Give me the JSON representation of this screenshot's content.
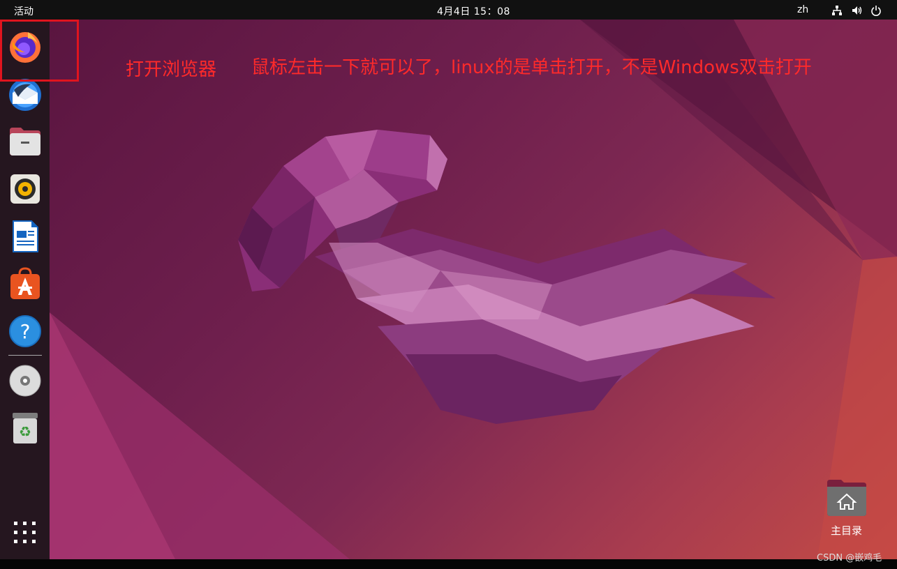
{
  "topbar": {
    "activities": "活动",
    "clock": "4月4日  15：08",
    "language": "zh",
    "tray_icons": [
      "network-icon",
      "volume-icon",
      "power-icon"
    ]
  },
  "dock": {
    "items": [
      {
        "name": "firefox",
        "icon": "firefox-icon"
      },
      {
        "name": "thunderbird",
        "icon": "thunderbird-icon"
      },
      {
        "name": "files",
        "icon": "files-icon"
      },
      {
        "name": "rhythmbox",
        "icon": "rhythmbox-icon"
      },
      {
        "name": "libreoffice-writer",
        "icon": "writer-icon"
      },
      {
        "name": "software",
        "icon": "software-icon"
      },
      {
        "name": "help",
        "icon": "help-icon"
      },
      {
        "name": "dvd-drive",
        "icon": "dvd-icon"
      },
      {
        "name": "trash",
        "icon": "trash-icon"
      },
      {
        "name": "show-apps",
        "icon": "grid-icon"
      }
    ]
  },
  "annotations": {
    "open_browser": "打开浏览器",
    "instruction": "鼠标左击一下就可以了，linux的是单击打开，不是Windows双击打开"
  },
  "desktop": {
    "home_label": "主目录"
  },
  "watermark": "CSDN @嵌鸡毛",
  "colors": {
    "annotation": "#ff2a2a",
    "highlight_border": "#e0141e",
    "dock_bg": "#25161f",
    "topbar_bg": "#111111"
  }
}
